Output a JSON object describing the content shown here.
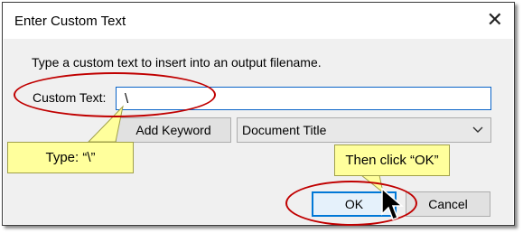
{
  "dialog": {
    "title": "Enter Custom Text",
    "instruction": "Type a custom text to insert into an output filename.",
    "custom_text_label": "Custom Text:",
    "custom_text_value": "\\",
    "add_keyword_label": "Add Keyword",
    "keyword_select_value": "Document Title",
    "ok_label": "OK",
    "cancel_label": "Cancel"
  },
  "annotations": {
    "type_callout": "Type: “\\”",
    "ok_callout": "Then click “OK”"
  },
  "icons": {
    "close": "close-icon",
    "dropdown": "chevron-down-icon",
    "cursor": "mouse-pointer-icon"
  },
  "colors": {
    "annotation_red": "#c00000",
    "callout_yellow": "#ffff9c",
    "focus_blue": "#0078d7"
  }
}
